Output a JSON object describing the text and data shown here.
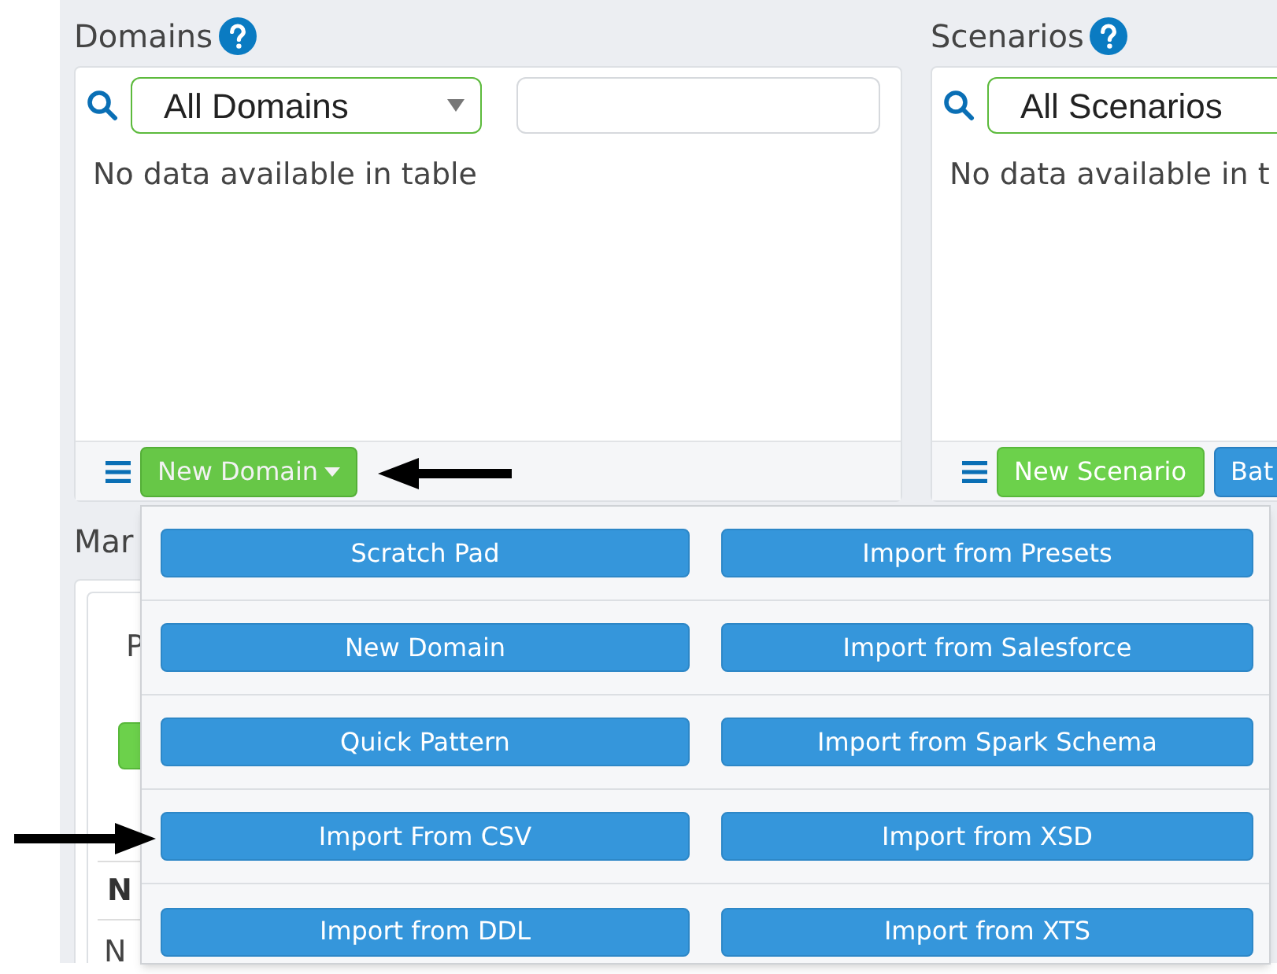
{
  "domains": {
    "title": "Domains",
    "filter": {
      "value": "All Domains"
    },
    "empty_message": "No data available in table",
    "new_button": {
      "label": "New Domain",
      "expanded": true
    }
  },
  "scenarios": {
    "title": "Scenarios",
    "filter": {
      "value": "All Scenarios"
    },
    "empty_message": "No data available in t",
    "buttons": [
      {
        "label": "New Scenario",
        "kind": "success"
      },
      {
        "label": "Bat",
        "kind": "primary"
      }
    ]
  },
  "lower_section": {
    "title": "Mar",
    "tab_label": "P",
    "column_header": "N",
    "cell": "N"
  },
  "menu": {
    "items": [
      "Scratch Pad",
      "Import from Presets",
      "New Domain",
      "Import from Salesforce",
      "Quick Pattern",
      "Import from Spark Schema",
      "Import From CSV",
      "Import from XSD",
      "Import from DDL",
      "Import from XTS"
    ]
  },
  "annotations": [
    {
      "kind": "arrow-left"
    },
    {
      "kind": "arrow-right"
    }
  ]
}
